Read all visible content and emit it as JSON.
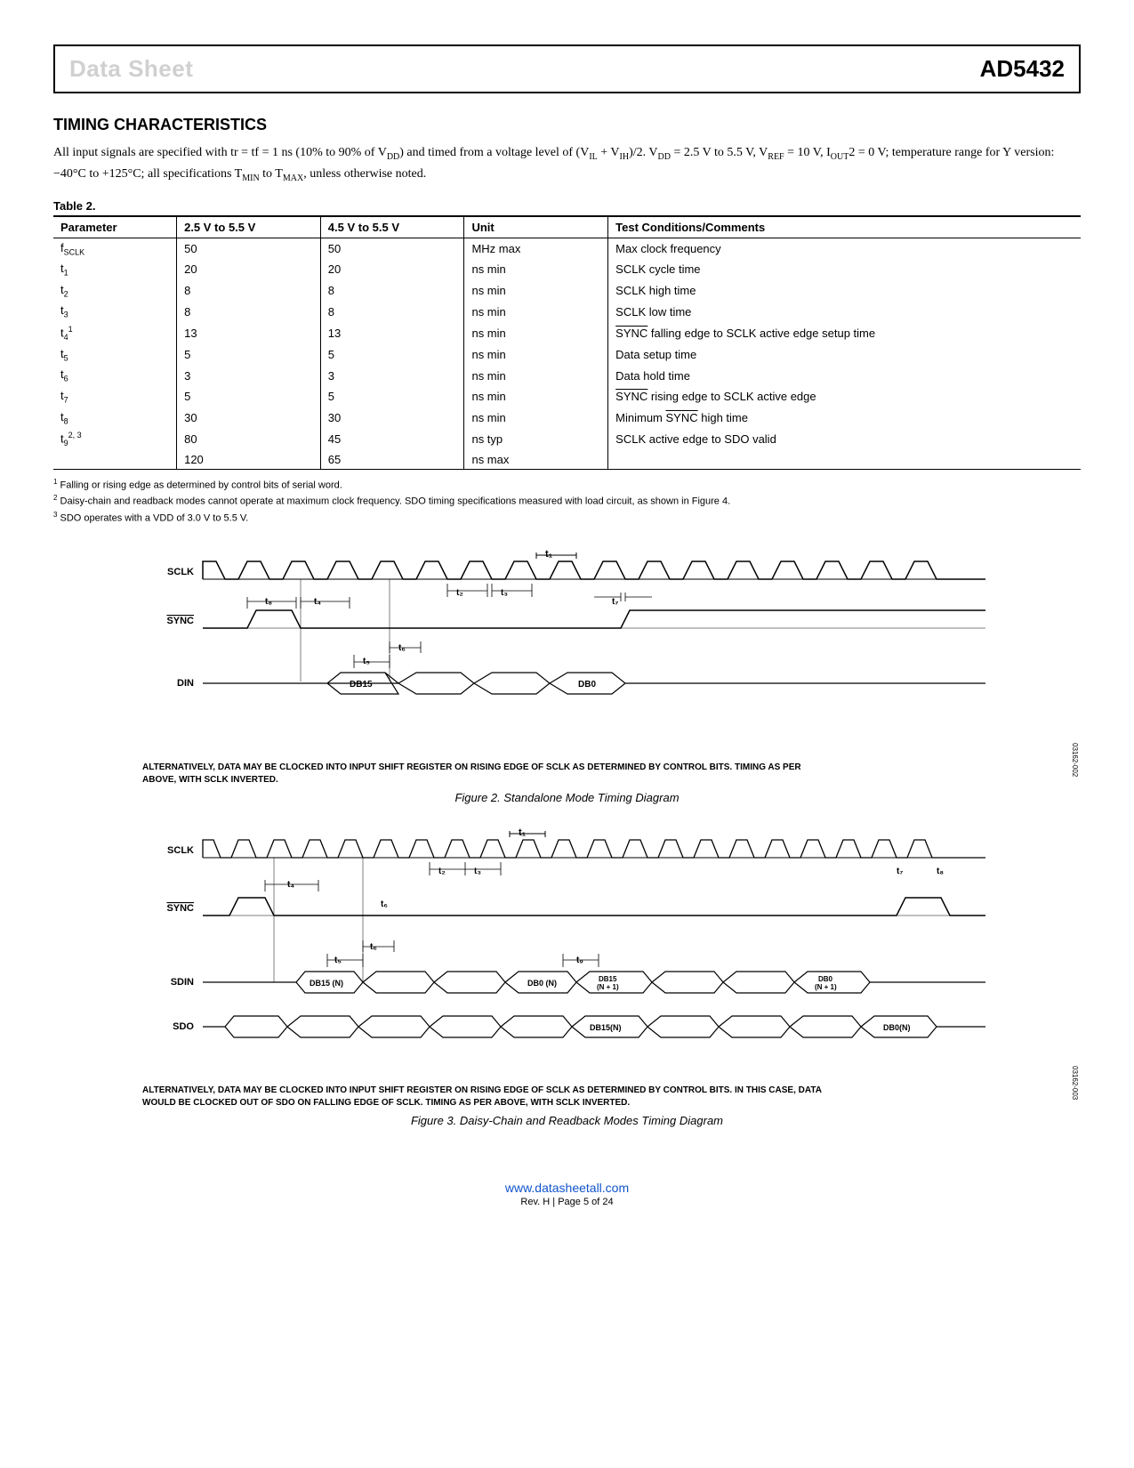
{
  "header": {
    "left": "Data Sheet",
    "right": "AD5432"
  },
  "section_title": "TIMING CHARACTERISTICS",
  "conditions_html": "All input signals are specified with tr = tf = 1 ns (10% to 90% of V<sub>DD</sub>) and timed from a voltage level of (V<sub>IL</sub> + V<sub>IH</sub>)/2. V<sub>DD</sub> = 2.5 V to 5.5 V, V<sub>REF</sub> = 10 V, I<sub>OUT</sub>2 = 0 V; temperature range for Y version: −40°C to +125°C; all specifications T<sub>MIN</sub> to T<sub>MAX</sub>, unless otherwise noted.",
  "table": {
    "label": "Table 2.",
    "headers": [
      "Parameter",
      "2.5 V to 5.5 V",
      "4.5 V to 5.5 V",
      "Unit",
      "Test Conditions/Comments"
    ],
    "rows": [
      {
        "param": "f<sub>SCLK</sub>",
        "v1": "50",
        "v2": "50",
        "unit": "MHz max",
        "cond": "Max clock frequency"
      },
      {
        "param": "t<sub>1</sub>",
        "v1": "20",
        "v2": "20",
        "unit": "ns min",
        "cond": "SCLK cycle time"
      },
      {
        "param": "t<sub>2</sub>",
        "v1": "8",
        "v2": "8",
        "unit": "ns min",
        "cond": "SCLK high time"
      },
      {
        "param": "t<sub>3</sub>",
        "v1": "8",
        "v2": "8",
        "unit": "ns min",
        "cond": "SCLK low time"
      },
      {
        "param": "t<sub>4</sub><sup>1</sup>",
        "v1": "13",
        "v2": "13",
        "unit": "ns min",
        "cond": "<span class=\"overline\">SYNC</span> falling edge to SCLK active edge setup time"
      },
      {
        "param": "t<sub>5</sub>",
        "v1": "5",
        "v2": "5",
        "unit": "ns min",
        "cond": "Data setup time"
      },
      {
        "param": "t<sub>6</sub>",
        "v1": "3",
        "v2": "3",
        "unit": "ns min",
        "cond": "Data hold time"
      },
      {
        "param": "t<sub>7</sub>",
        "v1": "5",
        "v2": "5",
        "unit": "ns min",
        "cond": "<span class=\"overline\">SYNC</span> rising edge to SCLK active edge"
      },
      {
        "param": "t<sub>8</sub>",
        "v1": "30",
        "v2": "30",
        "unit": "ns min",
        "cond": "Minimum <span class=\"overline\">SYNC</span> high time"
      },
      {
        "param": "t<sub>9</sub><sup>2, 3</sup>",
        "v1": "80",
        "v2": "45",
        "unit": "ns typ",
        "cond": "SCLK active edge to SDO valid"
      },
      {
        "param": "",
        "v1": "120",
        "v2": "65",
        "unit": "ns max",
        "cond": ""
      }
    ]
  },
  "footnotes": [
    "<sup>1</sup> Falling or rising edge as determined by control bits of serial word.",
    "<sup>2</sup> Daisy-chain and readback modes cannot operate at maximum clock frequency. SDO timing specifications measured with load circuit, as shown in Figure 4.",
    "<sup>3</sup> SDO operates with a VDD of 3.0 V to 5.5 V."
  ],
  "figure1": {
    "signals": {
      "sclk": "SCLK",
      "sync": "SYNC",
      "din": "DIN"
    },
    "timing": {
      "t1": "t₁",
      "t2": "t₂",
      "t3": "t₃",
      "t4": "t₄",
      "t5": "t₅",
      "t6": "t₆",
      "t7": "t₇",
      "t8": "t₈"
    },
    "bits": {
      "db15": "DB15",
      "db0": "DB0"
    },
    "note": "ALTERNATIVELY, DATA MAY BE CLOCKED INTO INPUT SHIFT REGISTER ON RISING EDGE OF SCLK AS DETERMINED BY CONTROL BITS. TIMING AS PER ABOVE, WITH SCLK INVERTED.",
    "caption": "Figure 2. Standalone Mode Timing Diagram",
    "id": "03162-002"
  },
  "figure2": {
    "signals": {
      "sclk": "SCLK",
      "sync": "SYNC",
      "sdin": "SDIN",
      "sdo": "SDO"
    },
    "timing": {
      "t1": "t₁",
      "t2": "t₂",
      "t3": "t₃",
      "t4": "t₄",
      "t5": "t₅",
      "t6": "t₆",
      "t7": "t₇",
      "t8": "t₈",
      "t9": "t₉"
    },
    "bits": {
      "db15n": "DB15 (N)",
      "db0n": "DB0 (N)",
      "db15n1a": "DB15",
      "db15n1b": "(N + 1)",
      "db0n1a": "DB0",
      "db0n1b": "(N + 1)",
      "db15nr": "DB15(N)",
      "db0nr": "DB0(N)"
    },
    "note": "ALTERNATIVELY, DATA MAY BE CLOCKED INTO INPUT SHIFT REGISTER ON RISING EDGE OF SCLK AS DETERMINED BY CONTROL BITS. IN THIS CASE, DATA WOULD BE CLOCKED OUT OF SDO ON FALLING EDGE OF SCLK. TIMING AS PER ABOVE, WITH SCLK INVERTED.",
    "caption": "Figure 3. Daisy-Chain and Readback Modes Timing Diagram",
    "id": "03162-003"
  },
  "footer": {
    "url": "www.datasheetall.com",
    "rev": "Rev. H | Page 5 of 24"
  }
}
